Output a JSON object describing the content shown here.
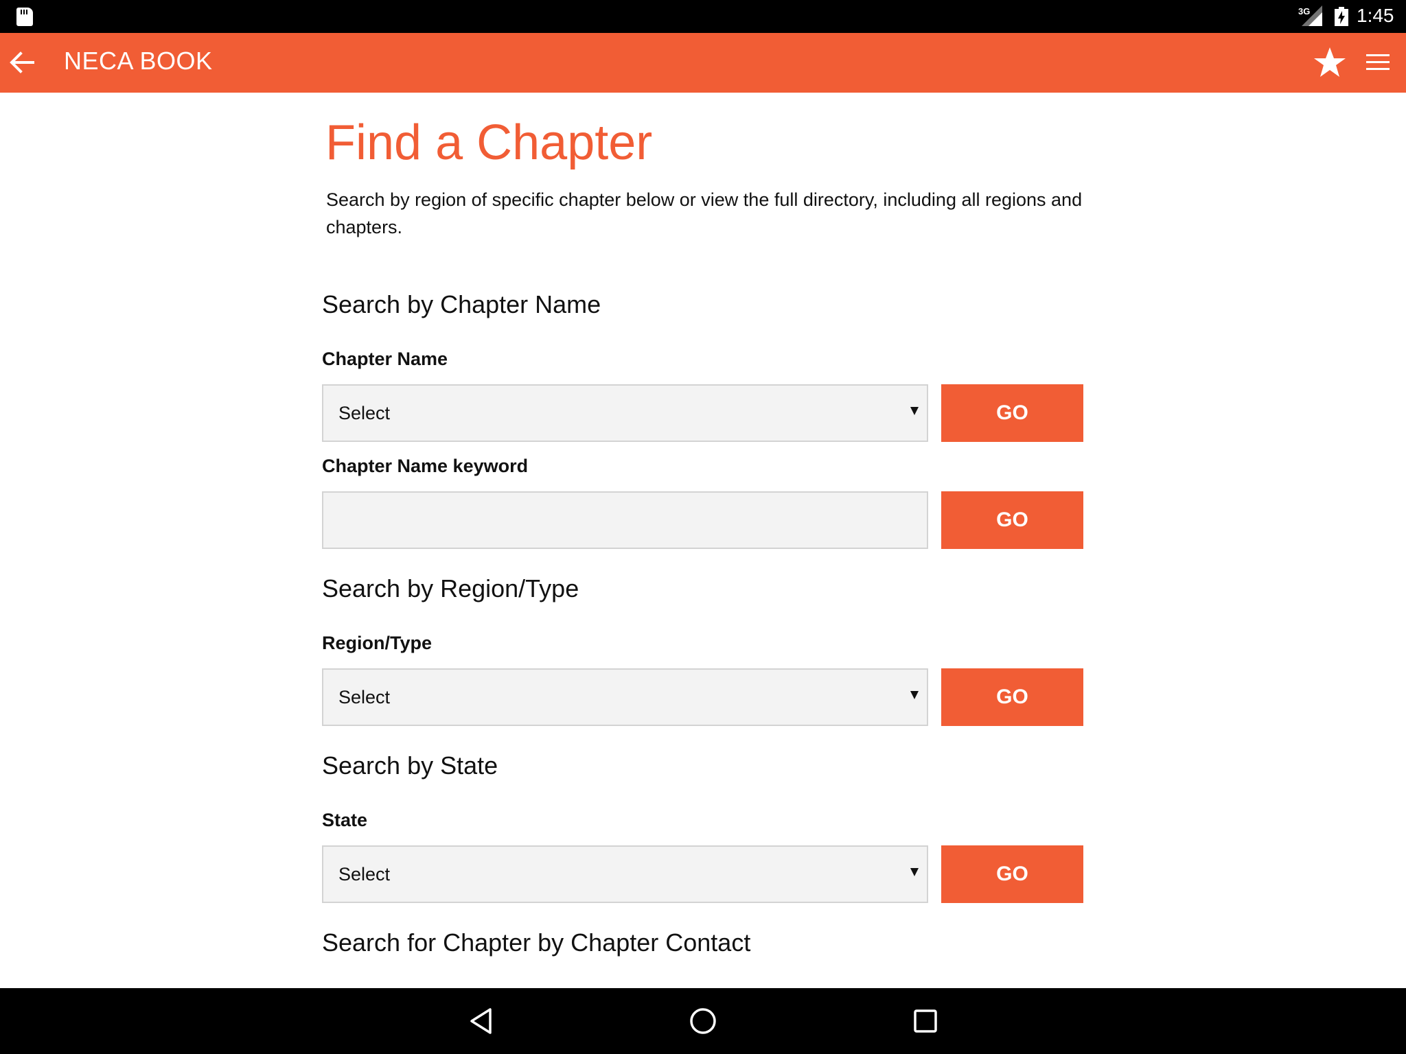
{
  "status_bar": {
    "network_label": "3G",
    "time": "1:45"
  },
  "app_bar": {
    "title": "NECA BOOK",
    "icons": {
      "back": "arrow-left-icon",
      "favorite": "star-icon",
      "menu": "hamburger-menu-icon"
    }
  },
  "page": {
    "title": "Find a Chapter",
    "intro": "Search by region of specific chapter below or view the full directory, including all regions and chapters."
  },
  "sections": {
    "chapter_name": {
      "heading": "Search by Chapter Name",
      "select_label": "Chapter Name",
      "select_value": "Select",
      "keyword_label": "Chapter Name keyword",
      "keyword_value": "",
      "go_label": "GO"
    },
    "region": {
      "heading": "Search by Region/Type",
      "select_label": "Region/Type",
      "select_value": "Select",
      "go_label": "GO"
    },
    "state": {
      "heading": "Search by State",
      "select_label": "State",
      "select_value": "Select",
      "go_label": "GO"
    },
    "contact": {
      "heading": "Search for Chapter by Chapter Contact"
    }
  },
  "colors": {
    "brand": "#f15d35",
    "text": "#111111",
    "field_bg": "#f3f3f3",
    "field_border": "#d3d3d3"
  },
  "nav_bar": {
    "back": "triangle-back-icon",
    "home": "circle-home-icon",
    "recents": "square-recents-icon"
  }
}
